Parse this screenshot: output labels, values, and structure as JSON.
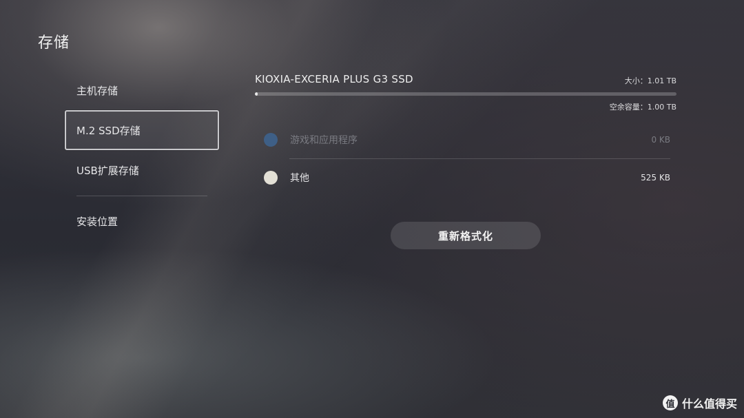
{
  "page": {
    "title": "存储"
  },
  "sidebar": {
    "items": [
      {
        "label": "主机存储",
        "selected": false
      },
      {
        "label": "M.2 SSD存储",
        "selected": true
      },
      {
        "label": "USB扩展存储",
        "selected": false
      },
      {
        "label": "安装位置",
        "selected": false
      }
    ]
  },
  "drive": {
    "name": "KIOXIA-EXCERIA PLUS G3 SSD",
    "size_text": "大小：1.01 TB",
    "free_text": "空余容量：1.00 TB",
    "used_fraction": 0.006,
    "categories": [
      {
        "label": "游戏和应用程序",
        "value": "0 KB",
        "color": "#3e5f86",
        "state": "dim"
      },
      {
        "label": "其他",
        "value": "525 KB",
        "color": "#e3e0d6",
        "state": "normal"
      }
    ]
  },
  "actions": {
    "format_label": "重新格式化"
  },
  "watermark": {
    "logo_glyph": "值",
    "text": "什么值得买"
  },
  "colors": {
    "accent_bar": "#e8e8e8",
    "games_dot": "#3e5f86",
    "other_dot": "#e3e0d6"
  }
}
